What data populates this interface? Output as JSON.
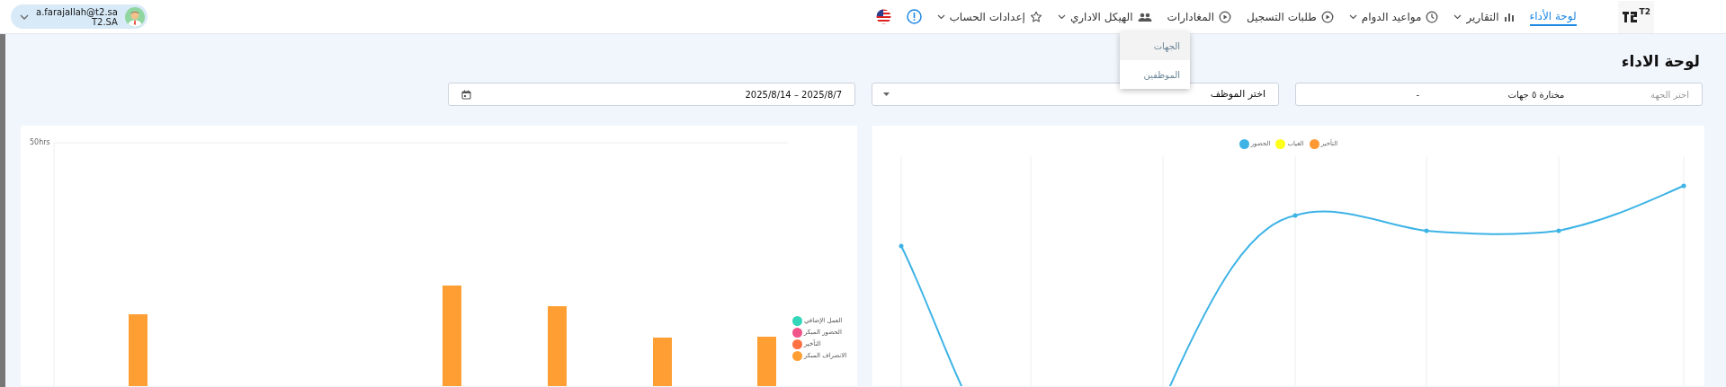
{
  "header": {
    "logo_text": "T2",
    "nav": [
      {
        "label": "لوحة الأداء",
        "selected": true,
        "dropdown": false
      },
      {
        "label": "التقارير",
        "selected": false,
        "dropdown": true
      },
      {
        "label": "مواعيد الدوام",
        "selected": false,
        "dropdown": true
      },
      {
        "label": "طلبات التسجيل",
        "selected": false,
        "dropdown": false
      },
      {
        "label": "المغادارات",
        "selected": false,
        "dropdown": false
      },
      {
        "label": "الهيكل الاداري",
        "selected": false,
        "dropdown": true
      },
      {
        "label": "إعدادات الحساب",
        "selected": false,
        "dropdown": true
      }
    ],
    "user": {
      "email": "a.farajallah@t2.sa",
      "org": "T2.SA"
    }
  },
  "open_menu": {
    "items": [
      {
        "label": "الجهات",
        "selected": true
      },
      {
        "label": "الموظفين",
        "selected": false
      }
    ]
  },
  "page_title": "لوحة الاداء",
  "filters": [
    {
      "kind": "select",
      "placeholder": "اختر الجهة",
      "value": "مختارة ٥ جهات",
      "separator": "-"
    },
    {
      "kind": "select",
      "value": "اختر الموظف"
    },
    {
      "kind": "date",
      "value": "2025/8/14 – 2025/8/7"
    }
  ],
  "line_chart": {
    "legend": [
      {
        "label": "التأخير",
        "color": "#ff9933"
      },
      {
        "label": "الغياب",
        "color": "#ffff1a"
      },
      {
        "label": "الحضور",
        "color": "#3db3e6"
      }
    ]
  },
  "bar_chart": {
    "y_label": "50hrs",
    "legend": [
      {
        "label": "العمل الإضافي",
        "color": "#33d6b8"
      },
      {
        "label": "الحضور المبكر",
        "color": "#f0558a"
      },
      {
        "label": "التأخير",
        "color": "#ff7043"
      },
      {
        "label": "الانصراف المبكر",
        "color": "#ff9f33"
      }
    ]
  }
}
